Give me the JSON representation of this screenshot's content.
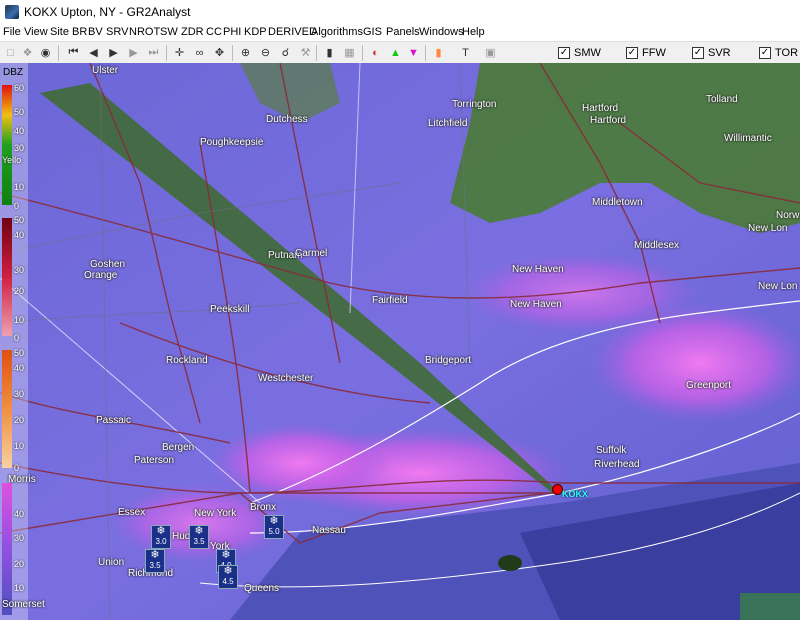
{
  "window": {
    "title": "KOKX Upton, NY - GR2Analyst"
  },
  "menu": [
    "File",
    "View",
    "Site",
    "BR",
    "BV",
    "SRV",
    "NROT",
    "SW",
    "ZDR",
    "CC",
    "PHI",
    "KDP",
    "DERIVED",
    "Algorithms",
    "GIS",
    "Panels",
    "Windows",
    "Help"
  ],
  "toolbar": {
    "checks": [
      {
        "label": "SMW",
        "checked": true
      },
      {
        "label": "FFW",
        "checked": true
      },
      {
        "label": "SVR",
        "checked": true
      },
      {
        "label": "TOR",
        "checked": true
      }
    ]
  },
  "legend": {
    "unit": "DBZ",
    "tick_labels": [
      "60",
      "50",
      "40",
      "30",
      "Yello",
      "10",
      "0",
      "50",
      "40",
      "30",
      "20",
      "10",
      "0",
      "50",
      "40",
      "30",
      "20",
      "10",
      "0",
      "40",
      "30",
      "20",
      "10"
    ]
  },
  "places": [
    "Ulster",
    "Dutchess",
    "Poughkeepsie",
    "Torrington",
    "Litchfield",
    "Hartford",
    "Hartford",
    "Tolland",
    "Willimantic",
    "Middletown",
    "Middlesex",
    "Norw",
    "New Lon",
    "New Lon",
    "Goshen",
    "Orange",
    "Putnam",
    "Carmel",
    "New Haven",
    "New Haven",
    "Fairfield",
    "Peekskill",
    "Rockland",
    "Westchester",
    "Bridgeport",
    "Greenport",
    "Passaic",
    "Bergen",
    "Paterson",
    "Suffolk",
    "Riverhead",
    "Morris",
    "Essex",
    "New York",
    "Bronx",
    "Nassau",
    "Hudson",
    "York",
    "Union",
    "Richmond",
    "Queens",
    "Somerset"
  ],
  "radar_site": "KOKX",
  "snow_totals": [
    "3.0",
    "3.5",
    "3.5",
    "5.0",
    "4.0",
    "4.5"
  ]
}
